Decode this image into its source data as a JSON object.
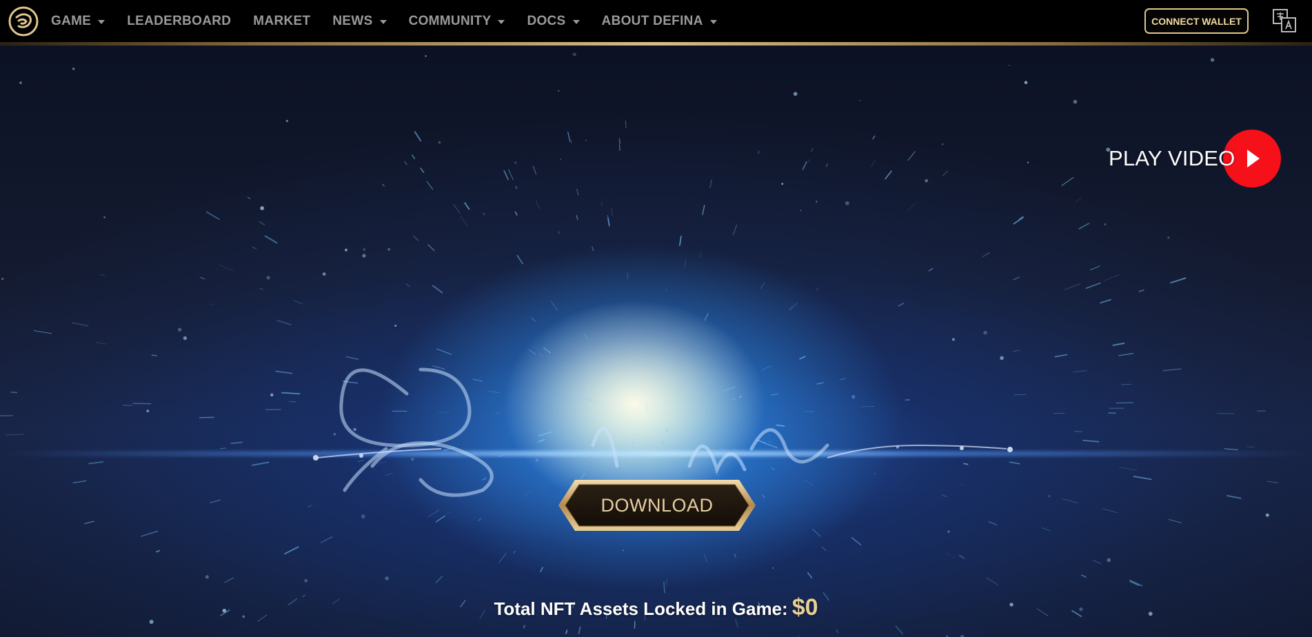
{
  "nav": {
    "items": [
      {
        "label": "GAME",
        "dropdown": true
      },
      {
        "label": "LEADERBOARD",
        "dropdown": false
      },
      {
        "label": "MARKET",
        "dropdown": false
      },
      {
        "label": "NEWS",
        "dropdown": true
      },
      {
        "label": "COMMUNITY",
        "dropdown": true
      },
      {
        "label": "DOCS",
        "dropdown": true
      },
      {
        "label": "ABOUT DEFINA",
        "dropdown": true
      }
    ],
    "connect_wallet_label": "CONNECT WALLET",
    "logo_icon": "defina-logo-icon",
    "language_icon": "translate-icon"
  },
  "hero": {
    "play_video_label": "PLAY VIDEO",
    "download_label": "DOWNLOAD",
    "locked_label": "Total NFT Assets Locked in Game:",
    "locked_value": "$0"
  },
  "colors": {
    "navbar_bg": "#000000",
    "nav_text": "#9a9a9a",
    "gold_accent": "#e3c98a",
    "play_button_red": "#f5101a",
    "locked_value_gold": "#e7cf95"
  }
}
